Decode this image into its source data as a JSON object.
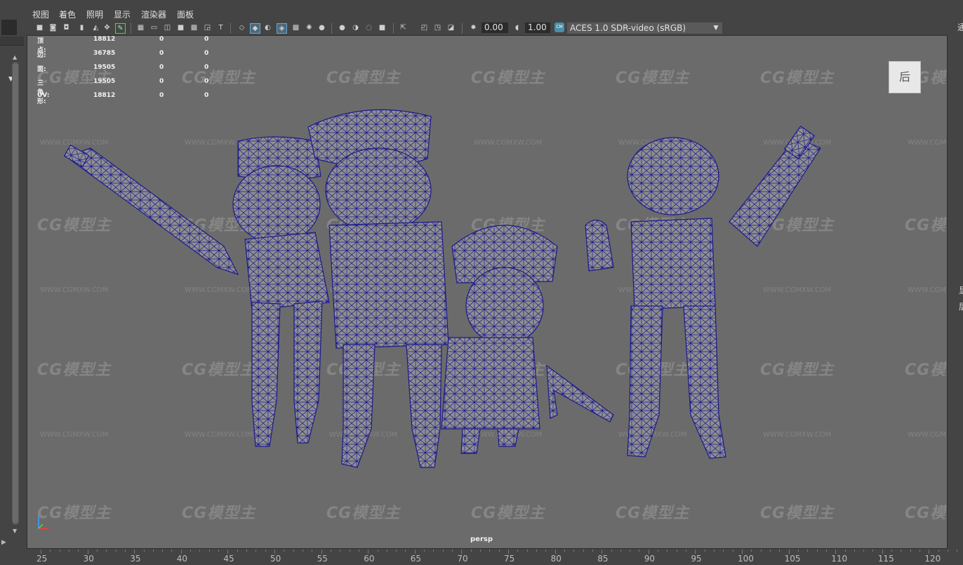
{
  "menubar": {
    "items": [
      "视图",
      "着色",
      "照明",
      "显示",
      "渲染器",
      "面板"
    ]
  },
  "toolbar": {
    "exposure_value": "0.00",
    "gamma_value": "1.00",
    "color_space": "ACES 1.0 SDR-video (sRGB)",
    "icons": [
      "select-camera-icon",
      "camera-attributes-icon",
      "bookmark-icon",
      "image-plane-icon",
      "grid-icon",
      "film-gate-icon",
      "resolution-gate-icon",
      "gate-mask-icon",
      "field-chart-icon",
      "safe-action-icon",
      "safe-title-icon",
      "wireframe-icon",
      "smooth-shade-icon",
      "default-material-icon",
      "wireframe-on-shaded-icon",
      "textured-icon",
      "use-all-lights-icon",
      "shadows-icon",
      "ambient-occlusion-icon",
      "motion-blur-icon",
      "anti-aliasing-icon",
      "depth-of-field-icon",
      "isolate-select-icon",
      "xray-icon",
      "xray-joints-icon",
      "xray-components-icon",
      "exposure-icon",
      "gamma-icon",
      "color-management-icon"
    ]
  },
  "hud": {
    "rows": [
      {
        "label": "顶点:",
        "v1": "18812",
        "v2": "0",
        "v3": "0"
      },
      {
        "label": "边:",
        "v1": "36785",
        "v2": "0",
        "v3": "0"
      },
      {
        "label": "面:",
        "v1": "19505",
        "v2": "0",
        "v3": "0"
      },
      {
        "label": "三角形:",
        "v1": "19505",
        "v2": "0",
        "v3": "0"
      },
      {
        "label": "UV:",
        "v1": "18812",
        "v2": "0",
        "v3": "0"
      }
    ]
  },
  "viewport": {
    "camera": "persp",
    "watermark_text": "CG模型主",
    "watermark_url": "WWW.CGMXW.COM",
    "wireframe_color": "#1c1a8c",
    "background_color": "#6b6b6b"
  },
  "view_cube": {
    "face_label": "后"
  },
  "ruler": {
    "labels": [
      "25",
      "30",
      "35",
      "40",
      "45",
      "50",
      "55",
      "60",
      "65",
      "70",
      "75",
      "80",
      "85",
      "90",
      "95",
      "100",
      "105",
      "110",
      "115",
      "120"
    ]
  },
  "right_panel": {
    "top_text": "通",
    "mid_text1": "显",
    "mid_text2": "层"
  }
}
